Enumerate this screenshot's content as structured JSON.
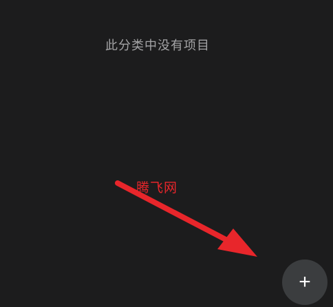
{
  "empty_state": {
    "message": "此分类中没有项目"
  },
  "watermark": {
    "text": "腾飞网"
  },
  "fab": {
    "icon": "plus-icon",
    "glyph": "+"
  },
  "colors": {
    "background": "#1c1c1d",
    "message_text": "#a4a4a6",
    "annotation_red": "#e8262b",
    "fab_background": "#3b3d3f",
    "fab_icon": "#ffffff"
  }
}
